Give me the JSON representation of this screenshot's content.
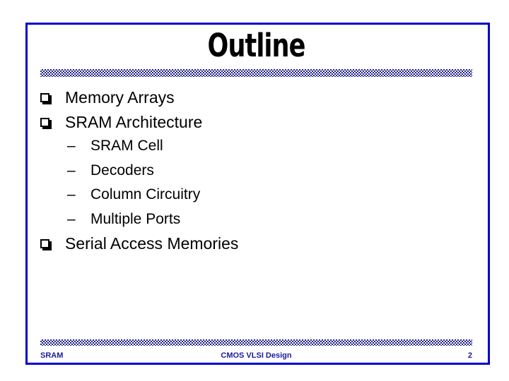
{
  "slide": {
    "title": "Outline",
    "page_number": "2",
    "frame_color": "#0000CC",
    "rule_color": "#22228C",
    "footer_text_color": "#1A1A99",
    "body_text_color": "#000000"
  },
  "body": {
    "items": [
      {
        "level": 1,
        "marker": "box-bullet",
        "text": "Memory Arrays"
      },
      {
        "level": 1,
        "marker": "box-bullet",
        "text": "SRAM Architecture"
      },
      {
        "level": 2,
        "marker": "–",
        "text": "SRAM Cell"
      },
      {
        "level": 2,
        "marker": "–",
        "text": "Decoders"
      },
      {
        "level": 2,
        "marker": "–",
        "text": "Column Circuitry"
      },
      {
        "level": 2,
        "marker": "–",
        "text": "Multiple Ports"
      },
      {
        "level": 1,
        "marker": "box-bullet",
        "text": "Serial Access Memories"
      }
    ]
  },
  "footer": {
    "left": "SRAM",
    "center": "CMOS VLSI Design",
    "right": "2"
  }
}
